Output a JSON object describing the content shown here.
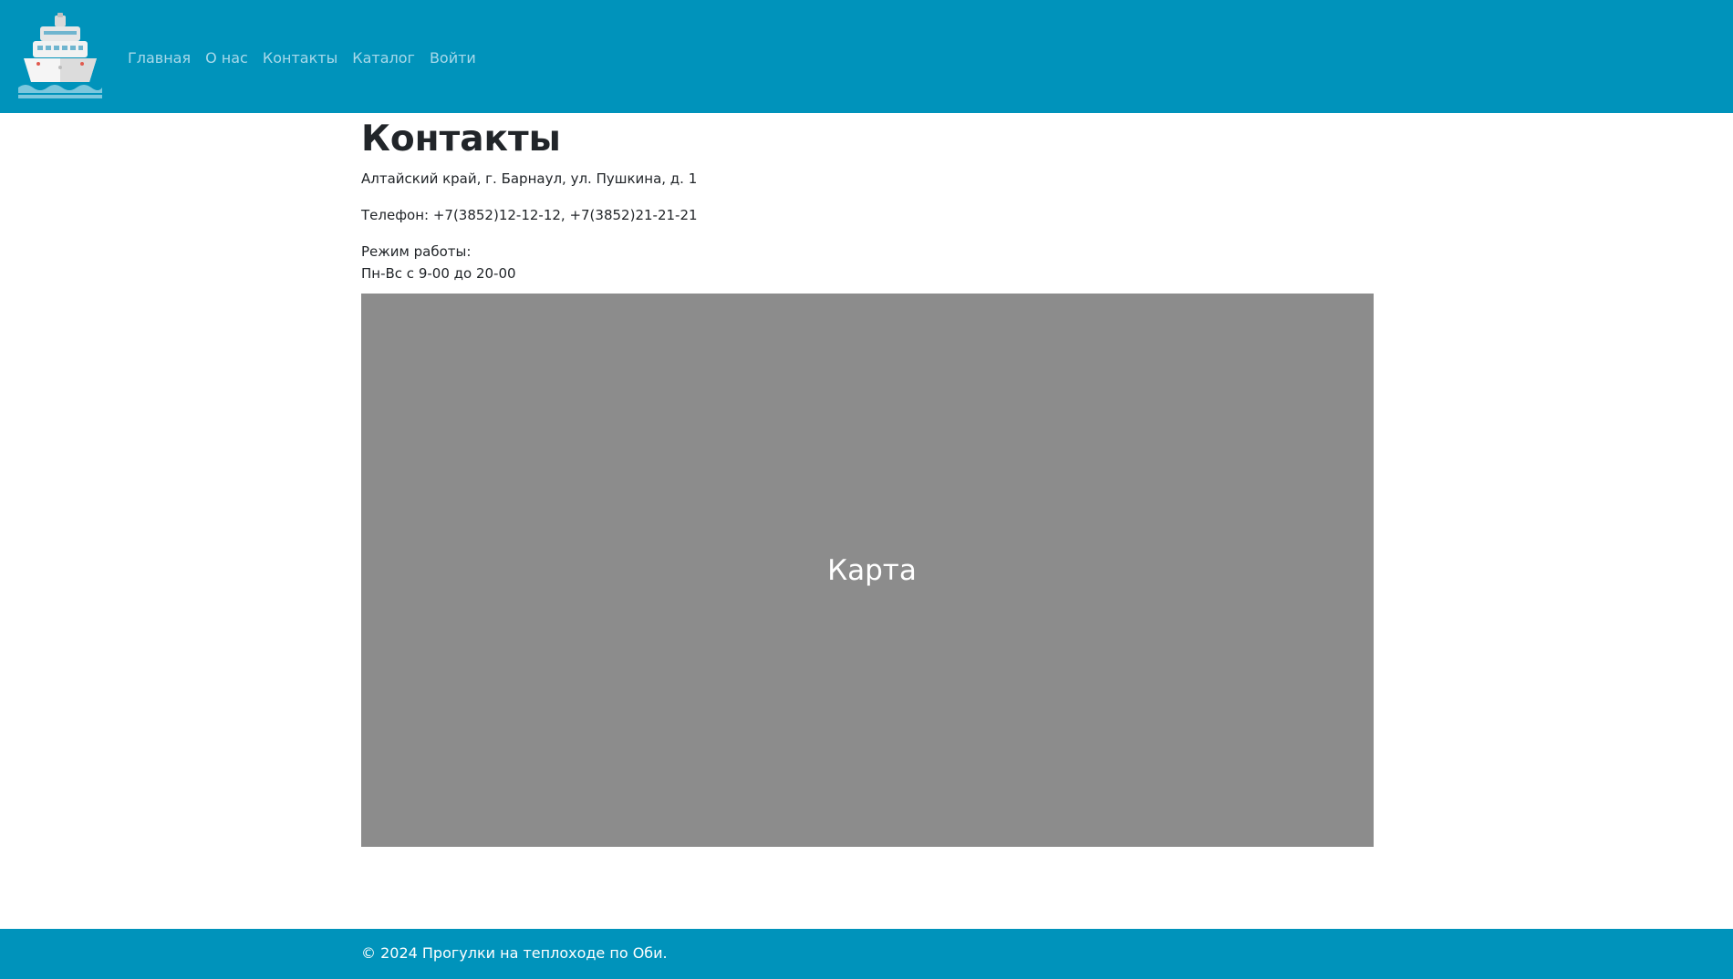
{
  "header": {
    "logo_icon": "ship-icon",
    "nav": [
      "Главная",
      "О нас",
      "Контакты",
      "Каталог",
      "Войти"
    ]
  },
  "main": {
    "title": "Контакты",
    "address": "Алтайский край, г. Барнаул, ул. Пушкина, д. 1",
    "phone": "Телефон: +7(3852)12-12-12, +7(3852)21-21-21",
    "hours_label": "Режим работы:",
    "hours": "Пн-Вс с 9-00 до 20-00",
    "map_label": "Карта"
  },
  "footer": {
    "copyright": "© 2024 Прогулки на теплоходе по Оби."
  },
  "colors": {
    "header_bg": "#0093bb",
    "nav_link": "#a8d9ea",
    "map_bg": "#8c8c8c"
  }
}
